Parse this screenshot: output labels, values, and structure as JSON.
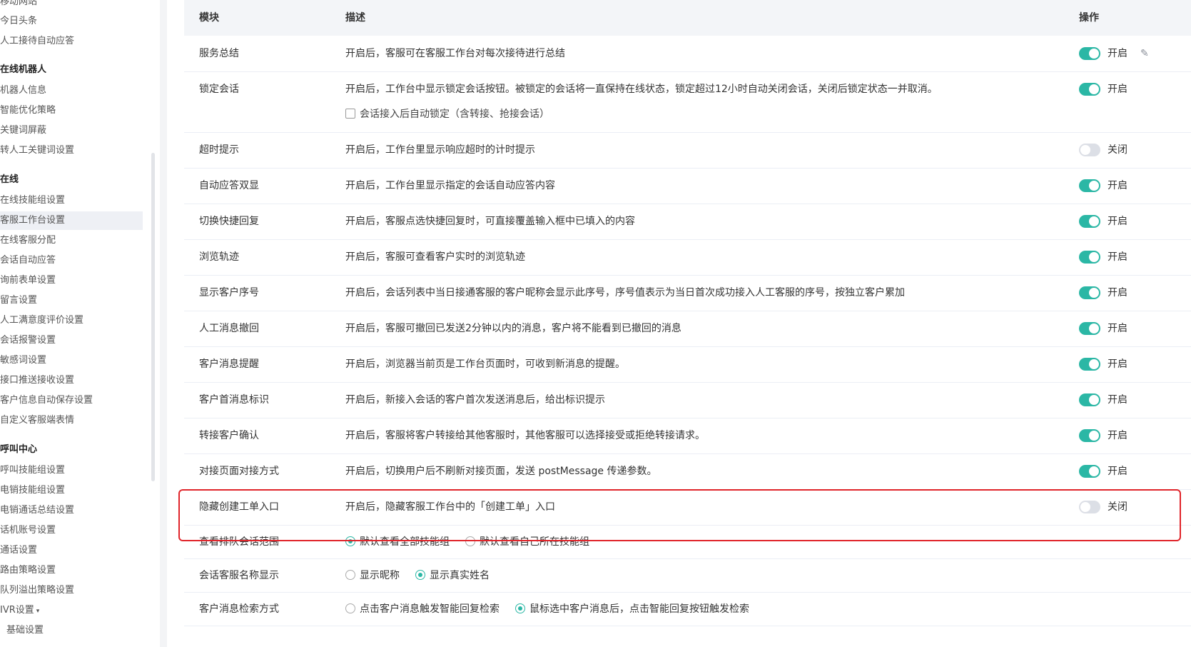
{
  "sidebar": {
    "items": [
      {
        "label": "移动网站",
        "type": "item"
      },
      {
        "label": "今日头条",
        "type": "item"
      },
      {
        "label": "人工接待自动应答",
        "type": "item"
      },
      {
        "label": "在线机器人",
        "type": "section"
      },
      {
        "label": "机器人信息",
        "type": "item"
      },
      {
        "label": "智能优化策略",
        "type": "item"
      },
      {
        "label": "关键词屏蔽",
        "type": "item"
      },
      {
        "label": "转人工关键词设置",
        "type": "item"
      },
      {
        "label": "在线",
        "type": "section"
      },
      {
        "label": "在线技能组设置",
        "type": "item"
      },
      {
        "label": "客服工作台设置",
        "type": "item",
        "active": true
      },
      {
        "label": "在线客服分配",
        "type": "item"
      },
      {
        "label": "会话自动应答",
        "type": "item"
      },
      {
        "label": "询前表单设置",
        "type": "item"
      },
      {
        "label": "留言设置",
        "type": "item"
      },
      {
        "label": "人工满意度评价设置",
        "type": "item"
      },
      {
        "label": "会话报警设置",
        "type": "item"
      },
      {
        "label": "敏感词设置",
        "type": "item"
      },
      {
        "label": "接口推送接收设置",
        "type": "item"
      },
      {
        "label": "客户信息自动保存设置",
        "type": "item"
      },
      {
        "label": "自定义客服端表情",
        "type": "item"
      },
      {
        "label": "呼叫中心",
        "type": "section"
      },
      {
        "label": "呼叫技能组设置",
        "type": "item"
      },
      {
        "label": "电销技能组设置",
        "type": "item"
      },
      {
        "label": "电销通话总结设置",
        "type": "item"
      },
      {
        "label": "话机账号设置",
        "type": "item"
      },
      {
        "label": "通话设置",
        "type": "item"
      },
      {
        "label": "路由策略设置",
        "type": "item"
      },
      {
        "label": "队列溢出策略设置",
        "type": "item"
      },
      {
        "label": "IVR设置",
        "type": "item",
        "caret": "▾"
      },
      {
        "label": "基础设置",
        "type": "sub"
      }
    ]
  },
  "table": {
    "headers": {
      "module": "模块",
      "desc": "描述",
      "action": "操作"
    },
    "rows": [
      {
        "name": "服务总结",
        "desc": "开启后，客服可在客服工作台对每次接待进行总结",
        "state": "on",
        "state_label": "开启",
        "edit": true
      },
      {
        "name": "锁定会话",
        "desc": "开启后，工作台中显示锁定会话按钮。被锁定的会话将一直保持在线状态，锁定超过12小时自动关闭会话，关闭后锁定状态一并取消。",
        "sub": "会话接入后自动锁定（含转接、抢接会话）",
        "state": "on",
        "state_label": "开启"
      },
      {
        "name": "超时提示",
        "desc": "开启后，工作台里显示响应超时的计时提示",
        "state": "off",
        "state_label": "关闭"
      },
      {
        "name": "自动应答双显",
        "desc": "开启后，工作台里显示指定的会话自动应答内容",
        "state": "on",
        "state_label": "开启"
      },
      {
        "name": "切换快捷回复",
        "desc": "开启后，客服点选快捷回复时，可直接覆盖输入框中已填入的内容",
        "state": "on",
        "state_label": "开启"
      },
      {
        "name": "浏览轨迹",
        "desc": "开启后，客服可查看客户实时的浏览轨迹",
        "state": "on",
        "state_label": "开启"
      },
      {
        "name": "显示客户序号",
        "desc": "开启后，会话列表中当日接通客服的客户昵称会显示此序号，序号值表示为当日首次成功接入人工客服的序号，按独立客户累加",
        "state": "on",
        "state_label": "开启"
      },
      {
        "name": "人工消息撤回",
        "desc": "开启后，客服可撤回已发送2分钟以内的消息，客户将不能看到已撤回的消息",
        "state": "on",
        "state_label": "开启"
      },
      {
        "name": "客户消息提醒",
        "desc": "开启后，浏览器当前页是工作台页面时，可收到新消息的提醒。",
        "state": "on",
        "state_label": "开启"
      },
      {
        "name": "客户首消息标识",
        "desc": "开启后，新接入会话的客户首次发送消息后，给出标识提示",
        "state": "on",
        "state_label": "开启"
      },
      {
        "name": "转接客户确认",
        "desc": "开启后，客服将客户转接给其他客服时，其他客服可以选择接受或拒绝转接请求。",
        "state": "on",
        "state_label": "开启"
      },
      {
        "name": "对接页面对接方式",
        "desc": "开启后，切换用户后不刷新对接页面，发送 postMessage 传递参数。",
        "state": "on",
        "state_label": "开启"
      },
      {
        "name": "隐藏创建工单入口",
        "desc": "开启后，隐藏客服工作台中的「创建工单」入口",
        "state": "off",
        "state_label": "关闭",
        "highlighted": true
      }
    ],
    "radio_rows": [
      {
        "name": "查看排队会话范围",
        "options": [
          {
            "label": "默认查看全部技能组",
            "checked": true
          },
          {
            "label": "默认查看自己所在技能组",
            "checked": false
          }
        ]
      },
      {
        "name": "会话客服名称显示",
        "options": [
          {
            "label": "显示昵称",
            "checked": false
          },
          {
            "label": "显示真实姓名",
            "checked": true
          }
        ]
      },
      {
        "name": "客户消息检索方式",
        "options": [
          {
            "label": "点击客户消息触发智能回复检索",
            "checked": false
          },
          {
            "label": "鼠标选中客户消息后，点击智能回复按钮触发检索",
            "checked": true
          }
        ]
      }
    ]
  },
  "colors": {
    "accent": "#2bb7a5",
    "highlight_border": "#e0242a",
    "toggle_off": "#dcdfe6"
  }
}
